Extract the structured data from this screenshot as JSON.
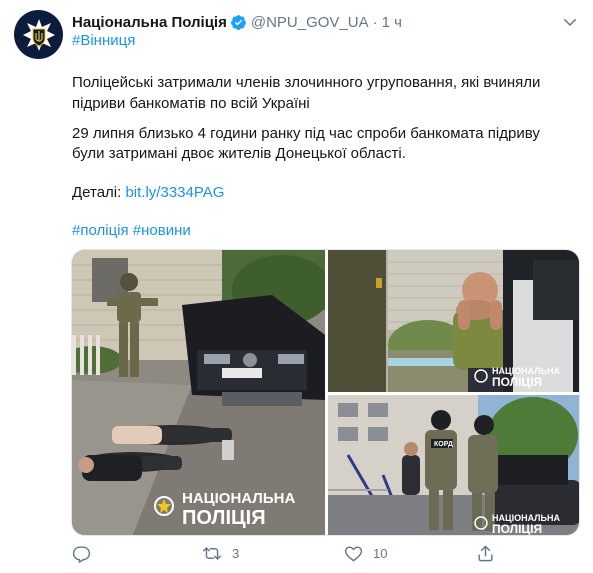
{
  "tweet": {
    "author_name": "Національна Поліція",
    "handle": "@NPU_GOV_UA",
    "separator": "·",
    "time": "1 ч",
    "location_tag": "#Вінниця",
    "body_line1": "Поліцейські затримали членів злочинного угруповання, які вчиняли",
    "body_line2": "підриви банкоматів по всій Україні",
    "body_line3": "29 липня близько 4 години ранку під час спроби банкомата підриву",
    "body_line4": "були затримані двоє жителів Донецької області.",
    "details_label": "Деталі: ",
    "details_link": "bit.ly/3334PAG",
    "tag1": "#поліція",
    "tag2": "#новини"
  },
  "media": {
    "watermark_line1": "НАЦІОНАЛЬНА",
    "watermark_line2": "ПОЛІЦІЯ",
    "small_watermark_line1": "НАЦІОНАЛЬНА",
    "small_watermark_line2": "ПОЛІЦІЯ",
    "vest_label": "КОРД",
    "plate_text": ""
  },
  "actions": {
    "retweet_count": "3",
    "like_count": "10"
  },
  "icons": {
    "avatar": "police-emblem-icon",
    "verified": "verified-badge-icon",
    "more": "chevron-down-icon",
    "reply": "reply-icon",
    "retweet": "retweet-icon",
    "like": "heart-icon",
    "share": "share-icon"
  },
  "colors": {
    "link": "#1b95e0",
    "muted": "#657786",
    "verified": "#1da1f2",
    "avatar_bg": "#0d1c3d"
  }
}
